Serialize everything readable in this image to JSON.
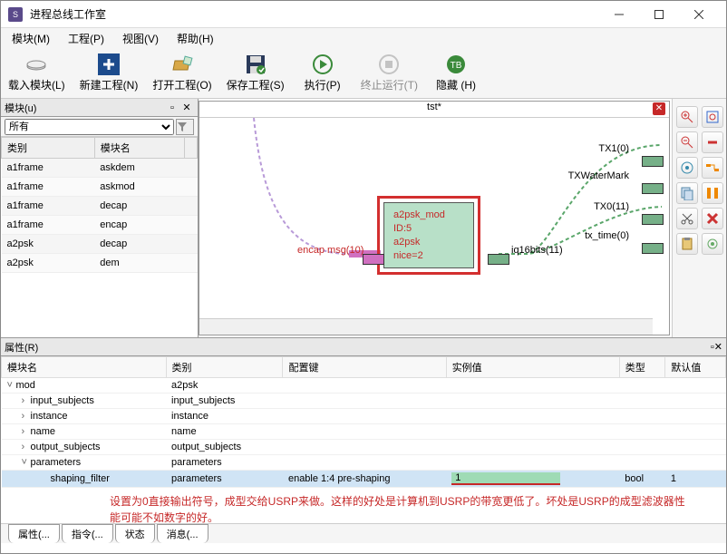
{
  "window": {
    "title": "进程总线工作室"
  },
  "menu": {
    "module": "模块(M)",
    "project": "工程(P)",
    "view": "视图(V)",
    "help": "帮助(H)"
  },
  "toolbar": {
    "load_module": "载入模块(L)",
    "new_project": "新建工程(N)",
    "open_project": "打开工程(O)",
    "save_project": "保存工程(S)",
    "execute": "执行(P)",
    "stop": "终止运行(T)",
    "hide": "隐藏 (H)"
  },
  "module_panel": {
    "title": "模块(u)",
    "filter": "所有",
    "columns": {
      "category": "类别",
      "name": "模块名"
    },
    "rows": [
      {
        "category": "a1frame",
        "name": "askdem"
      },
      {
        "category": "a1frame",
        "name": "askmod"
      },
      {
        "category": "a1frame",
        "name": "decap"
      },
      {
        "category": "a1frame",
        "name": "encap"
      },
      {
        "category": "a2psk",
        "name": "decap"
      },
      {
        "category": "a2psk",
        "name": "dem"
      }
    ]
  },
  "canvas": {
    "tab": "tst*",
    "node": {
      "l1": "a2psk_mod",
      "l2": "ID:5",
      "l3": "a2psk",
      "l4": "nice=2"
    },
    "ports": {
      "encap": "encap msg(10)",
      "iq": "iq16bits(11)",
      "tx1": "TX1(0)",
      "txwm": "TXWaterMark",
      "tx0": "TX0(11)",
      "txtime": "tx_time(0)"
    }
  },
  "chart_data": {
    "type": "table",
    "title": "属性(R)",
    "columns": [
      "模块名",
      "类别",
      "配置键",
      "实例值",
      "类型",
      "默认值"
    ],
    "rows": [
      {
        "indent": 0,
        "toggle": "v",
        "name": "mod",
        "cat": "a2psk",
        "key": "",
        "val": "",
        "type": "",
        "def": ""
      },
      {
        "indent": 1,
        "toggle": ">",
        "name": "input_subjects",
        "cat": "input_subjects",
        "key": "",
        "val": "",
        "type": "",
        "def": ""
      },
      {
        "indent": 1,
        "toggle": ">",
        "name": "instance",
        "cat": "instance",
        "key": "",
        "val": "",
        "type": "",
        "def": ""
      },
      {
        "indent": 1,
        "toggle": ">",
        "name": "name",
        "cat": "name",
        "key": "",
        "val": "",
        "type": "",
        "def": ""
      },
      {
        "indent": 1,
        "toggle": ">",
        "name": "output_subjects",
        "cat": "output_subjects",
        "key": "",
        "val": "",
        "type": "",
        "def": ""
      },
      {
        "indent": 1,
        "toggle": "v",
        "name": "parameters",
        "cat": "parameters",
        "key": "",
        "val": "",
        "type": "",
        "def": ""
      },
      {
        "indent": 2,
        "toggle": "",
        "name": "shaping_filter",
        "cat": "parameters",
        "key": "enable 1:4 pre-shaping",
        "val": "1",
        "type": "bool",
        "def": "1",
        "selected": true
      }
    ],
    "description": "设置为0直接输出符号，成型交给USRP来做。这样的好处是计算机到USRP的带宽更低了。坏处是USRP的成型滤波器性能可能不如数字的好。"
  },
  "tabs": {
    "prop": "属性(...",
    "cmd": "指令(...",
    "status": "状态",
    "msg": "消息(..."
  }
}
